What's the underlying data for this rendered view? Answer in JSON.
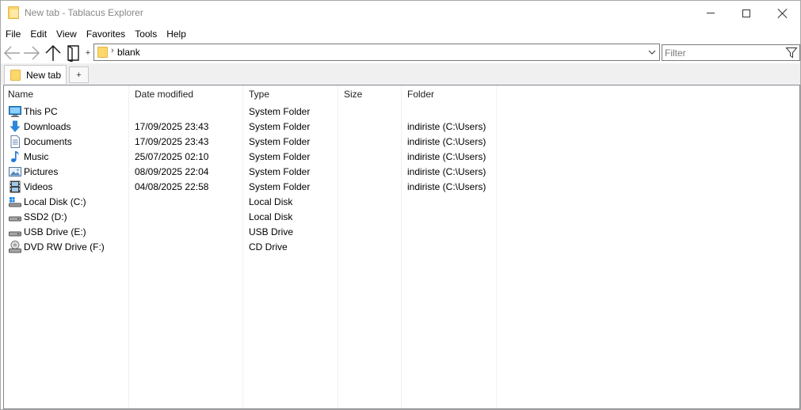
{
  "window": {
    "title": "New tab - Tablacus Explorer"
  },
  "menu": [
    "File",
    "Edit",
    "View",
    "Favorites",
    "Tools",
    "Help"
  ],
  "toolbar": {
    "plus_label": "+",
    "address_separator": "›",
    "address_value": "blank",
    "filter_placeholder": "Filter"
  },
  "tabs": {
    "active_label": "New tab",
    "add_label": "+"
  },
  "columns": {
    "name": "Name",
    "date": "Date modified",
    "type": "Type",
    "size": "Size",
    "folder": "Folder"
  },
  "rows": [
    {
      "name": "This PC",
      "date": "",
      "type": "System Folder",
      "folder": "",
      "icon": "computer-icon"
    },
    {
      "name": "Downloads",
      "date": "17/09/2025 23:43",
      "type": "System Folder",
      "folder": "indiriste (C:\\Users)",
      "icon": "download-icon"
    },
    {
      "name": "Documents",
      "date": "17/09/2025 23:43",
      "type": "System Folder",
      "folder": "indiriste (C:\\Users)",
      "icon": "document-icon"
    },
    {
      "name": "Music",
      "date": "25/07/2025 02:10",
      "type": "System Folder",
      "folder": "indiriste (C:\\Users)",
      "icon": "music-note-icon"
    },
    {
      "name": "Pictures",
      "date": "08/09/2025 22:04",
      "type": "System Folder",
      "folder": "indiriste (C:\\Users)",
      "icon": "picture-icon"
    },
    {
      "name": "Videos",
      "date": "04/08/2025 22:58",
      "type": "System Folder",
      "folder": "indiriste (C:\\Users)",
      "icon": "film-icon"
    },
    {
      "name": "Local Disk (C:)",
      "date": "",
      "type": "Local Disk",
      "folder": "",
      "icon": "system-drive-icon"
    },
    {
      "name": "SSD2 (D:)",
      "date": "",
      "type": "Local Disk",
      "folder": "",
      "icon": "drive-icon"
    },
    {
      "name": "USB Drive (E:)",
      "date": "",
      "type": "USB Drive",
      "folder": "",
      "icon": "usb-drive-icon"
    },
    {
      "name": "DVD RW Drive (F:)",
      "date": "",
      "type": "CD Drive",
      "folder": "",
      "icon": "dvd-drive-icon"
    }
  ],
  "colors": {
    "folder_yellow": "#fcd76a",
    "accent_blue": "#1e7ad6"
  }
}
